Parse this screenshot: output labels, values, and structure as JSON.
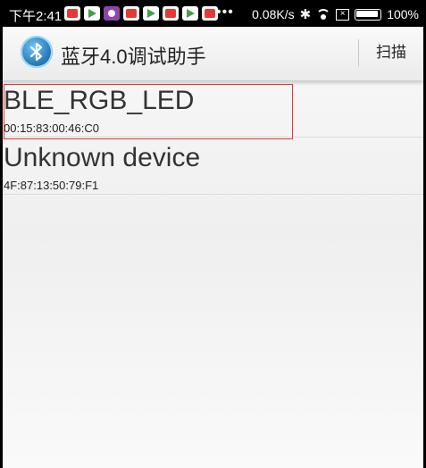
{
  "status_bar": {
    "time": "下午2:41",
    "notification_icons": [
      "weibo-icon",
      "play-store-icon",
      "app-icon",
      "weibo-icon",
      "play-store-icon",
      "weibo-icon",
      "play-store-icon",
      "weibo-icon"
    ],
    "more_indicator": "•••",
    "network_speed": "0.08K/s",
    "bluetooth_symbol": "✱",
    "sim_indicator": "×",
    "battery": "100%"
  },
  "app_bar": {
    "title": "蓝牙4.0调试助手",
    "scan_label": "扫描"
  },
  "devices": [
    {
      "name": "BLE_RGB_LED",
      "address": "00:15:83:00:46:C0"
    },
    {
      "name": "Unknown device",
      "address": "4F:87:13:50:79:F1"
    }
  ],
  "colors": {
    "selection_border": "#e53935",
    "app_bar_bg": "#f2f2f2",
    "content_bg": "#f4f4f4"
  }
}
